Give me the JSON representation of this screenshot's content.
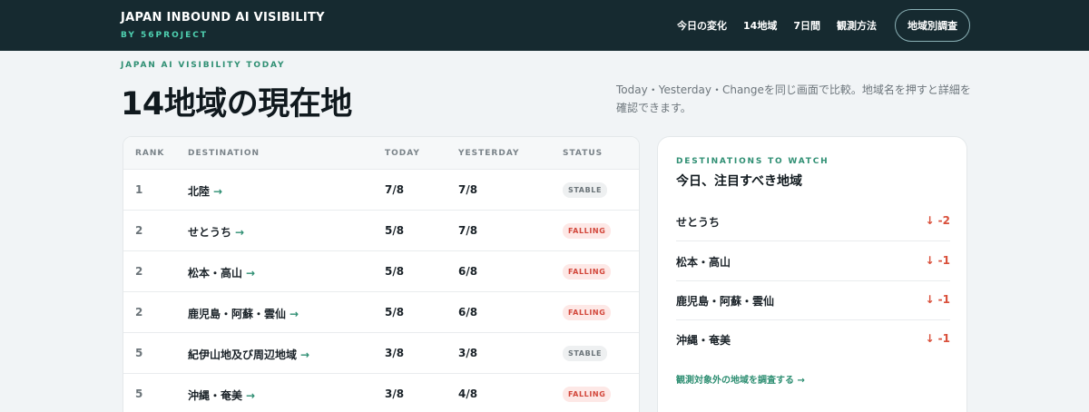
{
  "header": {
    "brand_title": "JAPAN INBOUND AI VISIBILITY",
    "brand_sub": "BY 56PROJECT",
    "nav": [
      "今日の変化",
      "14地域",
      "7日間",
      "観測方法"
    ],
    "cta": "地域別調査"
  },
  "intro": {
    "eyebrow": "JAPAN AI VISIBILITY TODAY",
    "title": "14地域の現在地",
    "description": "Today・Yesterday・Changeを同じ画面で比較。地域名を押すと詳細を確認できます。"
  },
  "table": {
    "headers": [
      "RANK",
      "DESTINATION",
      "TODAY",
      "YESTERDAY",
      "STATUS"
    ],
    "arrow": "→",
    "rows": [
      {
        "rank": "1",
        "dest": "北陸",
        "today": "7/8",
        "yesterday": "7/8",
        "status": "STABLE"
      },
      {
        "rank": "2",
        "dest": "せとうち",
        "today": "5/8",
        "yesterday": "7/8",
        "status": "FALLING"
      },
      {
        "rank": "2",
        "dest": "松本・高山",
        "today": "5/8",
        "yesterday": "6/8",
        "status": "FALLING"
      },
      {
        "rank": "2",
        "dest": "鹿児島・阿蘇・雲仙",
        "today": "5/8",
        "yesterday": "6/8",
        "status": "FALLING"
      },
      {
        "rank": "5",
        "dest": "紀伊山地及び周辺地域",
        "today": "3/8",
        "yesterday": "3/8",
        "status": "STABLE"
      },
      {
        "rank": "5",
        "dest": "沖縄・奄美",
        "today": "3/8",
        "yesterday": "4/8",
        "status": "FALLING"
      }
    ]
  },
  "watch": {
    "eyebrow": "DESTINATIONS TO WATCH",
    "title": "今日、注目すべき地域",
    "items": [
      {
        "name": "せとうち",
        "delta": "↓ -2"
      },
      {
        "name": "松本・高山",
        "delta": "↓ -1"
      },
      {
        "name": "鹿児島・阿蘇・雲仙",
        "delta": "↓ -1"
      },
      {
        "name": "沖縄・奄美",
        "delta": "↓ -1"
      }
    ],
    "link": "観測対象外の地域を調査する →"
  },
  "colors": {
    "header_bg": "#162a30",
    "accent_green": "#2f8f73",
    "falling_red": "#d2463a",
    "stable_gray": "#6b7479"
  }
}
